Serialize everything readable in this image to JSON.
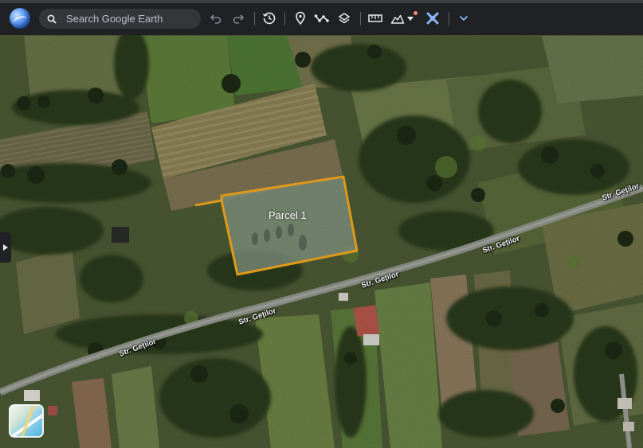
{
  "search": {
    "placeholder": "Search Google Earth"
  },
  "toolbar": {
    "icons": [
      "undo-icon",
      "redo-icon",
      "historical-imagery-icon",
      "add-placemark-icon",
      "add-path-icon",
      "layers-icon",
      "measure-icon",
      "map-style-icon",
      "projects-icon",
      "expand-icon"
    ]
  },
  "map": {
    "parcel": {
      "label": "Parcel 1",
      "outline_color": "#f4a81d"
    },
    "roads": [
      {
        "name": "Str. Geților"
      },
      {
        "name": "Str. Geților"
      },
      {
        "name": "Str. Geților"
      },
      {
        "name": "Str. Geților"
      }
    ]
  },
  "colors": {
    "toolbar_bg": "#202124",
    "search_bg": "#35363a",
    "accent": "#8ab4f8"
  }
}
